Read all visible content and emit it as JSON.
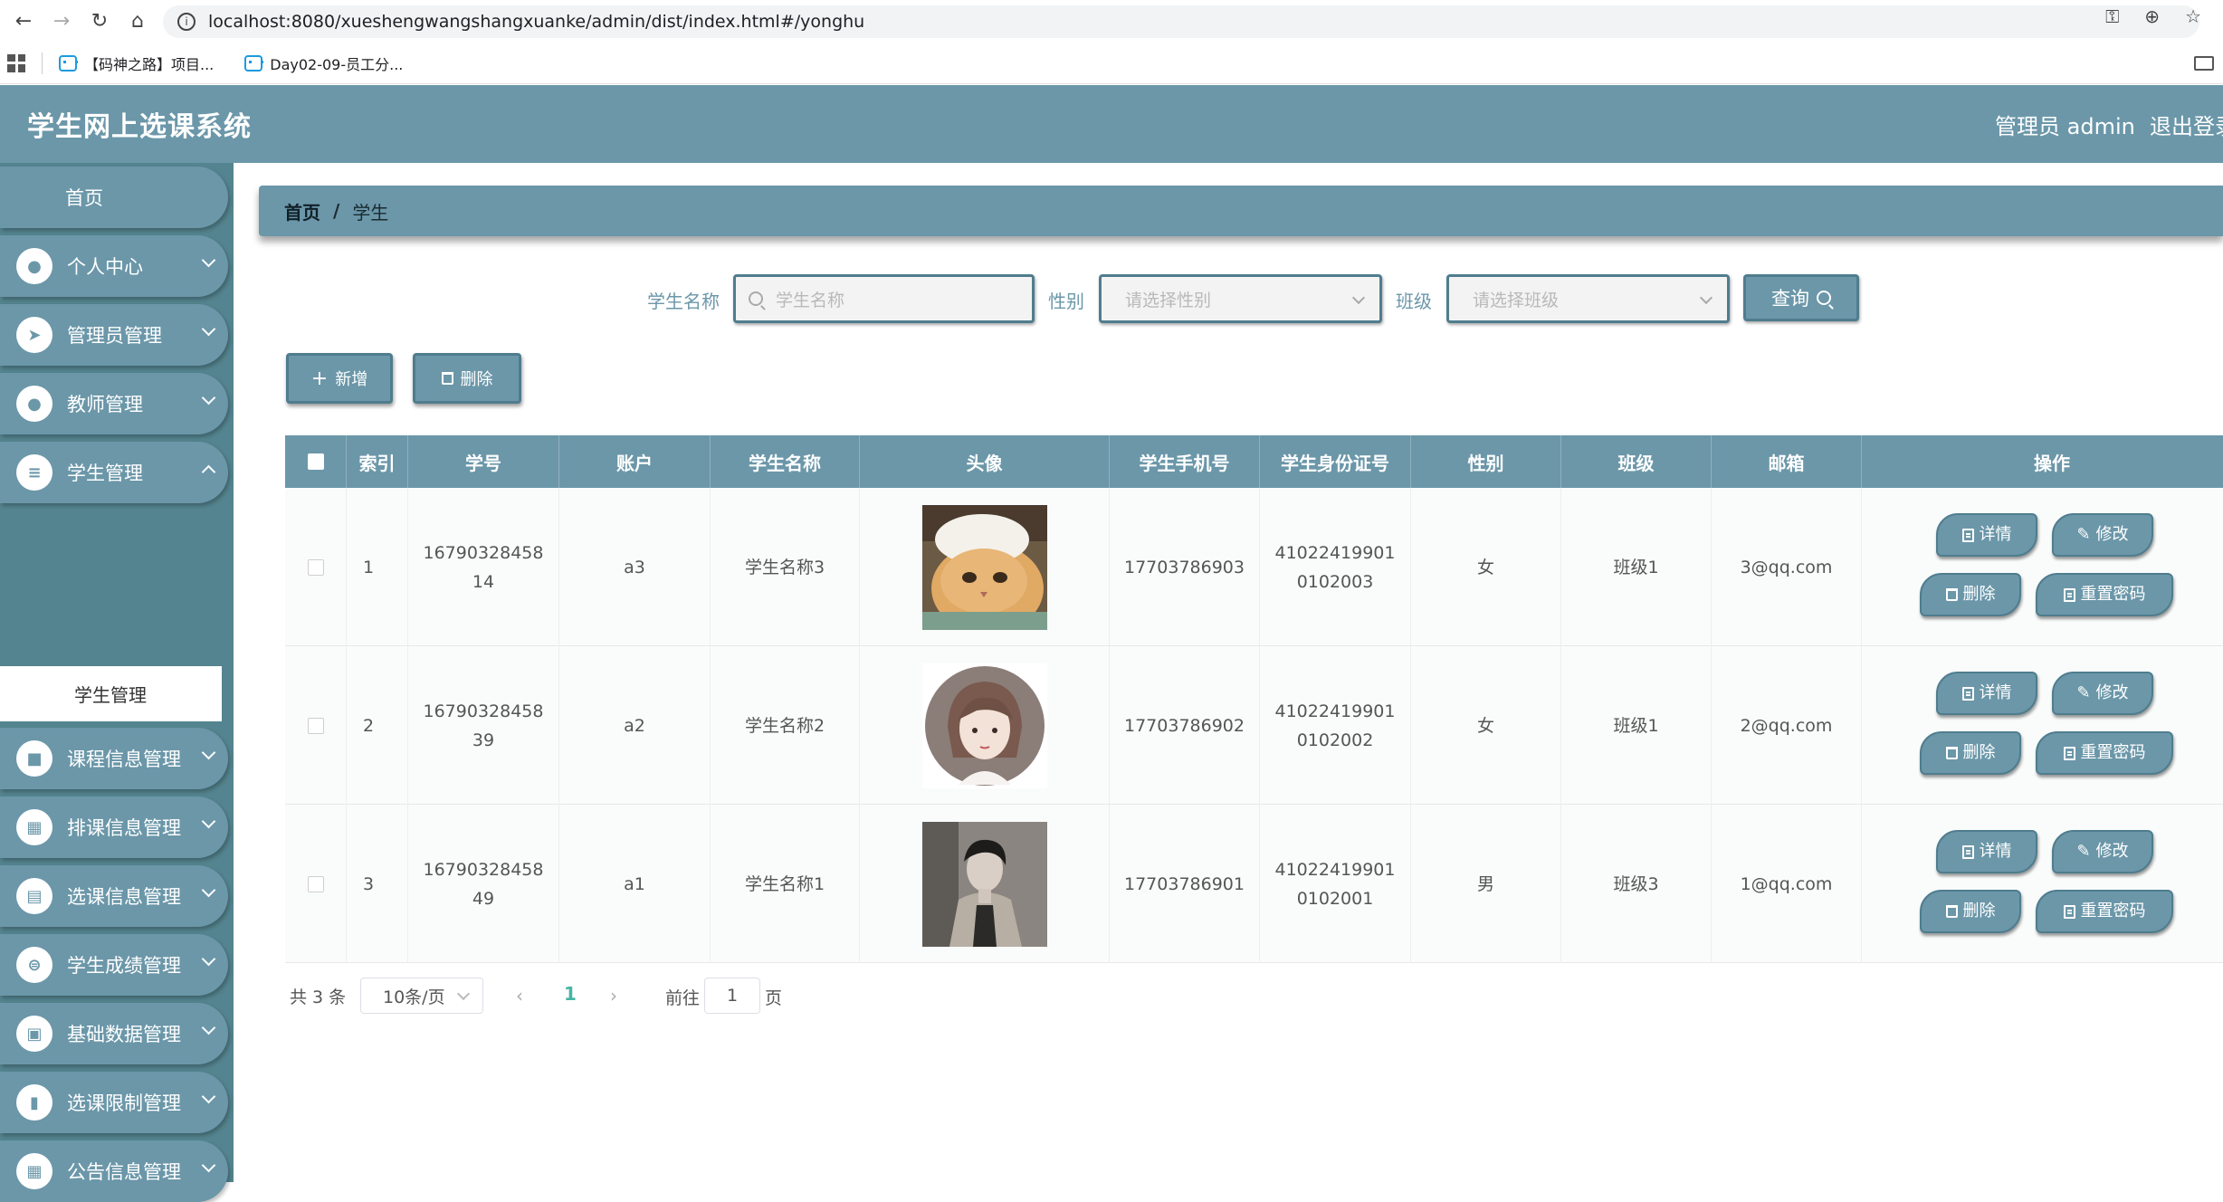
{
  "browser": {
    "url": "localhost:8080/xueshengwangshangxuanke/admin/dist/index.html#/yonghu",
    "bookmarks": [
      "【码神之路】项目...",
      "Day02-09-员工分..."
    ]
  },
  "header": {
    "title": "学生网上选课系统",
    "user": "管理员 admin",
    "logout": "退出登录"
  },
  "sidebar": {
    "home": "首页",
    "items": [
      {
        "label": "个人中心",
        "icon": "user-icon"
      },
      {
        "label": "管理员管理",
        "icon": "send-icon"
      },
      {
        "label": "教师管理",
        "icon": "user-icon"
      },
      {
        "label": "学生管理",
        "icon": "list-icon"
      },
      {
        "label": "课程信息管理",
        "icon": "briefcase-icon"
      },
      {
        "label": "排课信息管理",
        "icon": "grid-icon"
      },
      {
        "label": "选课信息管理",
        "icon": "clipboard-icon"
      },
      {
        "label": "学生成绩管理",
        "icon": "sliders-icon"
      },
      {
        "label": "基础数据管理",
        "icon": "chat-icon"
      },
      {
        "label": "选课限制管理",
        "icon": "book-icon"
      },
      {
        "label": "公告信息管理",
        "icon": "grid-icon"
      }
    ],
    "active_sub": "学生管理"
  },
  "breadcrumb": {
    "home": "首页",
    "sep": "/",
    "current": "学生"
  },
  "search": {
    "name_label": "学生名称",
    "name_placeholder": "学生名称",
    "gender_label": "性别",
    "gender_placeholder": "请选择性别",
    "class_label": "班级",
    "class_placeholder": "请选择班级",
    "query_button": "查询"
  },
  "actions": {
    "add": "新增",
    "delete": "删除"
  },
  "table": {
    "headers": [
      "索引",
      "学号",
      "账户",
      "学生名称",
      "头像",
      "学生手机号",
      "学生身份证号",
      "性别",
      "班级",
      "邮箱",
      "操作"
    ],
    "rows": [
      {
        "index": "1",
        "student_no": "1679032845814",
        "account": "a3",
        "name": "学生名称3",
        "avatar": "cat-photo",
        "phone": "17703786903",
        "id_card": "410224199010102003",
        "gender": "女",
        "class": "班级1",
        "email": "3@qq.com"
      },
      {
        "index": "2",
        "student_no": "1679032845839",
        "account": "a2",
        "name": "学生名称2",
        "avatar": "girl-illustration",
        "phone": "17703786902",
        "id_card": "410224199010102002",
        "gender": "女",
        "class": "班级1",
        "email": "2@qq.com"
      },
      {
        "index": "3",
        "student_no": "1679032845849",
        "account": "a1",
        "name": "学生名称1",
        "avatar": "man-photo",
        "phone": "17703786901",
        "id_card": "410224199010102001",
        "gender": "男",
        "class": "班级3",
        "email": "1@qq.com"
      }
    ],
    "ops": {
      "detail": "详情",
      "edit": "修改",
      "delete": "删除",
      "reset": "重置密码"
    }
  },
  "pagination": {
    "total": "共 3 条",
    "page_size": "10条/页",
    "current_page": "1",
    "goto_label": "前往",
    "goto_value": "1",
    "page_suffix": "页"
  },
  "colors": {
    "primary": "#6b97a9",
    "sidebar_bg": "#54848f",
    "active_page": "#47b5a4"
  }
}
